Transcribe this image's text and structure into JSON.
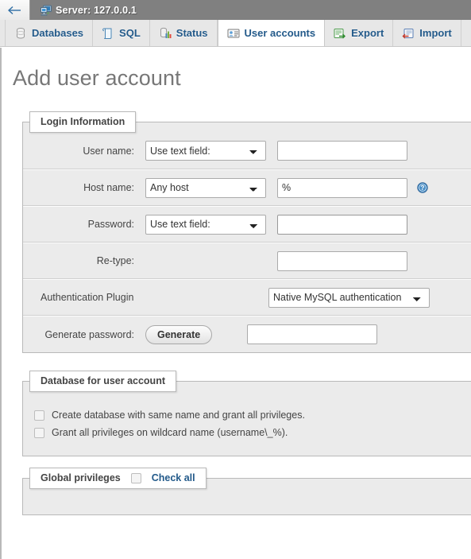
{
  "topbar": {
    "back_label": "←",
    "server_icon": "server-monitor-icon",
    "server_text": "Server: 127.0.0.1"
  },
  "tabs": [
    {
      "label": "Databases",
      "icon": "database-icon",
      "active": false
    },
    {
      "label": "SQL",
      "icon": "sql-document-icon",
      "active": false
    },
    {
      "label": "Status",
      "icon": "status-chart-icon",
      "active": false
    },
    {
      "label": "User accounts",
      "icon": "user-account-card-icon",
      "active": true
    },
    {
      "label": "Export",
      "icon": "export-icon",
      "active": false
    },
    {
      "label": "Import",
      "icon": "import-icon",
      "active": false
    }
  ],
  "page": {
    "title": "Add user account"
  },
  "login_information": {
    "legend": "Login Information",
    "rows": {
      "user_name": {
        "label": "User name:",
        "select_value": "Use text field:",
        "input_value": "",
        "input_placeholder": ""
      },
      "host_name": {
        "label": "Host name:",
        "select_value": "Any host",
        "input_value": "%",
        "help_icon": "help-question-icon"
      },
      "password": {
        "label": "Password:",
        "select_value": "Use text field:",
        "input_value": "",
        "focused": true
      },
      "retype": {
        "label": "Re-type:",
        "input_value": ""
      },
      "auth_plugin": {
        "label": "Authentication Plugin",
        "select_value": "Native MySQL authentication"
      },
      "generate_password": {
        "label": "Generate password:",
        "button_label": "Generate",
        "input_value": ""
      }
    }
  },
  "database_for_user": {
    "legend": "Database for user account",
    "checkboxes": [
      {
        "label": "Create database with same name and grant all privileges.",
        "checked": false
      },
      {
        "label": "Grant all privileges on wildcard name (username\\_%).",
        "checked": false
      }
    ]
  },
  "global_privileges": {
    "legend": "Global privileges",
    "check_all_label": "Check all",
    "check_all_checked": false
  },
  "colors": {
    "topbar_bg": "#808080",
    "tabbar_bg": "#e7e7e7",
    "link": "#235a8a",
    "fieldset_bg": "#ebebeb",
    "title": "#777777"
  }
}
